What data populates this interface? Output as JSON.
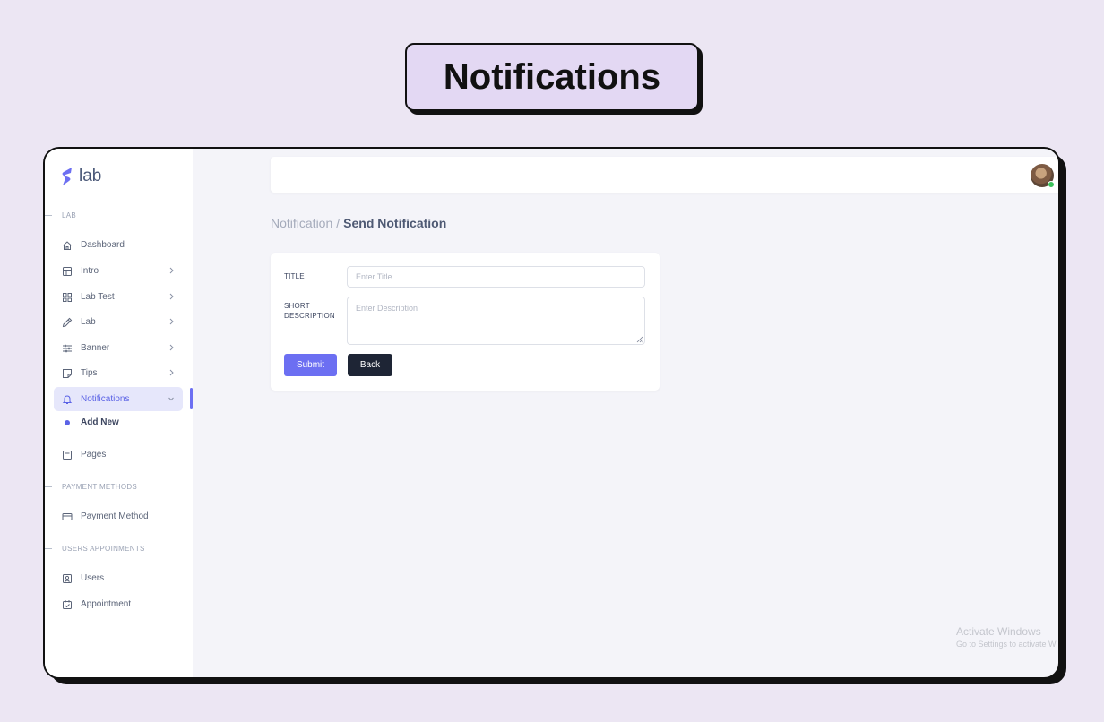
{
  "page_heading": "Notifications",
  "logo": {
    "text": "lab",
    "accent_color": "#6c6ff2"
  },
  "sidebar": {
    "sections": [
      {
        "label": "LAB"
      },
      {
        "label": "PAYMENT METHODS"
      },
      {
        "label": "USERS APPOINMENTS"
      }
    ],
    "items": [
      {
        "label": "Dashboard",
        "icon": "home-icon"
      },
      {
        "label": "Intro",
        "icon": "layout-icon",
        "has_children": true
      },
      {
        "label": "Lab Test",
        "icon": "grid-icon",
        "has_children": true
      },
      {
        "label": "Lab",
        "icon": "pen-icon",
        "has_children": true
      },
      {
        "label": "Banner",
        "icon": "sliders-icon",
        "has_children": true
      },
      {
        "label": "Tips",
        "icon": "sticky-note-icon",
        "has_children": true
      },
      {
        "label": "Notifications",
        "icon": "bell-icon",
        "has_children": true,
        "active": true
      },
      {
        "label": "Pages",
        "icon": "page-icon"
      },
      {
        "label": "Payment Method",
        "icon": "credit-card-icon"
      },
      {
        "label": "Users",
        "icon": "user-badge-icon"
      },
      {
        "label": "Appointment",
        "icon": "calendar-check-icon"
      }
    ],
    "sub_item": {
      "label": "Add New"
    }
  },
  "breadcrumb": {
    "parent": "Notification",
    "separator": "/",
    "current": "Send Notification"
  },
  "form": {
    "title_label": "TITLE",
    "title_placeholder": "Enter Title",
    "title_value": "",
    "desc_label_line1": "SHORT",
    "desc_label_line2": "DESCRIPTION",
    "desc_placeholder": "Enter Description",
    "desc_value": "",
    "submit_label": "Submit",
    "back_label": "Back"
  },
  "watermark": {
    "line1": "Activate Windows",
    "line2": "Go to Settings to activate W"
  },
  "colors": {
    "primary": "#6c6ff2",
    "dark": "#1e2535",
    "background": "#ece6f3",
    "heading_pill": "#e3d8f3"
  }
}
